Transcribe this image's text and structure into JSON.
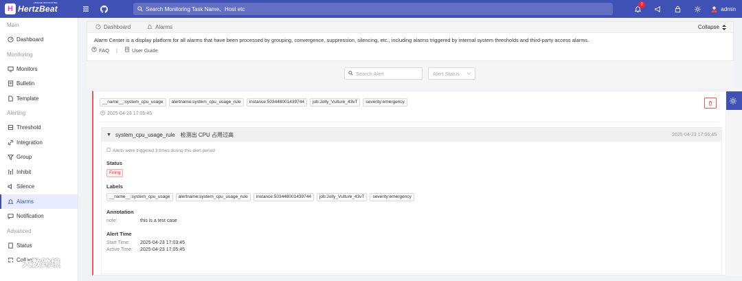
{
  "app": {
    "name": "HertzBeat",
    "tagline": "APACHE INCUBATING"
  },
  "header": {
    "search_placeholder": "Search Monitoring Task Name、Host etc",
    "notification_count": "2",
    "username": "admin"
  },
  "sidebar": {
    "groups": [
      {
        "label": "Main",
        "items": [
          {
            "label": "Dashboard",
            "icon": "dashboard-icon"
          }
        ]
      },
      {
        "label": "Monitoring",
        "items": [
          {
            "label": "Monitors",
            "icon": "monitor-icon"
          },
          {
            "label": "Bulletin",
            "icon": "bulletin-icon"
          },
          {
            "label": "Template",
            "icon": "template-icon"
          }
        ]
      },
      {
        "label": "Alerting",
        "items": [
          {
            "label": "Threshold",
            "icon": "threshold-icon"
          },
          {
            "label": "Integration",
            "icon": "integration-icon"
          },
          {
            "label": "Group",
            "icon": "group-icon"
          },
          {
            "label": "Inhibit",
            "icon": "inhibit-icon"
          },
          {
            "label": "Silence",
            "icon": "silence-icon"
          },
          {
            "label": "Alarms",
            "icon": "alarm-icon",
            "active": true
          },
          {
            "label": "Notification",
            "icon": "notification-icon"
          }
        ]
      },
      {
        "label": "Advanced",
        "items": [
          {
            "label": "Status",
            "icon": "status-icon"
          },
          {
            "label": "Collector",
            "icon": "collector-icon"
          }
        ]
      }
    ]
  },
  "breadcrumb_panel": {
    "tabs": [
      "Dashboard",
      "Alarms"
    ],
    "collapse_label": "Collapse",
    "description": "Alarm Center is a display platform for all alarms that have been processed by grouping, convergence, suppression, silencing, etc., including alarms triggered by internal system thresholds and third-party access alarms.",
    "faq_label": "FAQ",
    "guide_label": "User Guide"
  },
  "filters": {
    "search_placeholder": "Search Alert",
    "status_placeholder": "Alert Status"
  },
  "alert": {
    "tags": [
      "__name__:system_cpu_usage",
      "alertname:system_cpu_usage_rule",
      "instance:503448001439744",
      "job:Jolly_Vulture_43vT",
      "severity:emergency"
    ],
    "time": "2025-04-23 17:05:45",
    "detail": {
      "rule": "system_cpu_usage_rule",
      "summary": "检测出 CPU 占用过高",
      "time": "2025-04-23 17:05:45",
      "trigger_note": "Alerts were triggered 3 times during this alert period",
      "status_title": "Status",
      "status_value": "Firing",
      "labels_title": "Labels",
      "labels": [
        "__name__:system_cpu_usage",
        "alertname:system_cpu_usage_rule",
        "instance:503448001439744",
        "job:Jolly_Vulture_43vT",
        "severity:emergency"
      ],
      "annotation_title": "Annotation",
      "annotation_key": "note:",
      "annotation_value": "this is a test case",
      "alert_time_title": "Alert Time",
      "start_label": "Start Time:",
      "start_value": "2025-04-23 17:03:45",
      "active_label": "Active Time:",
      "active_value": "2025-04-23 17:05:45"
    }
  },
  "watermark": "大数跨境",
  "colors": {
    "primary": "#3f51b5",
    "danger": "#f5554a"
  }
}
